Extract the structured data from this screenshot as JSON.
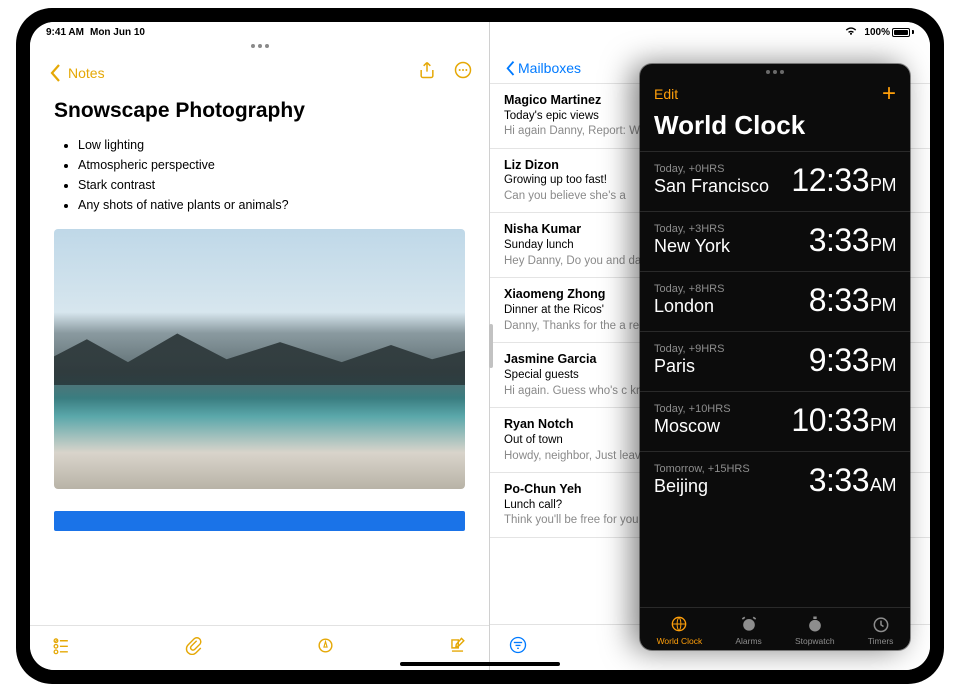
{
  "status": {
    "time": "9:41 AM",
    "date": "Mon Jun 10",
    "battery": "100%"
  },
  "notes": {
    "back_label": "Notes",
    "title": "Snowscape Photography",
    "bullets": [
      "Low lighting",
      "Atmospheric perspective",
      "Stark contrast",
      "Any shots of native plants or animals?"
    ]
  },
  "mail": {
    "back_label": "Mailboxes",
    "items": [
      {
        "sender": "Magico Martinez",
        "subject": "Today's epic views",
        "preview": "Hi again Danny, Report: Wide open skies, a ger"
      },
      {
        "sender": "Liz Dizon",
        "subject": "Growing up too fast!",
        "preview": "Can you believe she's a"
      },
      {
        "sender": "Nisha Kumar",
        "subject": "Sunday lunch",
        "preview": "Hey Danny, Do you and dad? If you two join, th"
      },
      {
        "sender": "Xiaomeng Zhong",
        "subject": "Dinner at the Ricos'",
        "preview": "Danny, Thanks for the a remembered to take or"
      },
      {
        "sender": "Jasmine Garcia",
        "subject": "Special guests",
        "preview": "Hi again. Guess who's c know how to make me"
      },
      {
        "sender": "Ryan Notch",
        "subject": "Out of town",
        "preview": "Howdy, neighbor, Just leaving Tuesday and wi"
      },
      {
        "sender": "Po-Chun Yeh",
        "subject": "Lunch call?",
        "preview": "Think you'll be free for you think might work a"
      }
    ]
  },
  "clock": {
    "edit_label": "Edit",
    "title": "World Clock",
    "cities": [
      {
        "offset": "Today, +0HRS",
        "city": "San Francisco",
        "time": "12:33",
        "ampm": "PM"
      },
      {
        "offset": "Today, +3HRS",
        "city": "New York",
        "time": "3:33",
        "ampm": "PM"
      },
      {
        "offset": "Today, +8HRS",
        "city": "London",
        "time": "8:33",
        "ampm": "PM"
      },
      {
        "offset": "Today, +9HRS",
        "city": "Paris",
        "time": "9:33",
        "ampm": "PM"
      },
      {
        "offset": "Today, +10HRS",
        "city": "Moscow",
        "time": "10:33",
        "ampm": "PM"
      },
      {
        "offset": "Tomorrow, +15HRS",
        "city": "Beijing",
        "time": "3:33",
        "ampm": "AM"
      }
    ],
    "tabs": [
      {
        "label": "World Clock",
        "active": true
      },
      {
        "label": "Alarms"
      },
      {
        "label": "Stopwatch"
      },
      {
        "label": "Timers"
      }
    ]
  }
}
